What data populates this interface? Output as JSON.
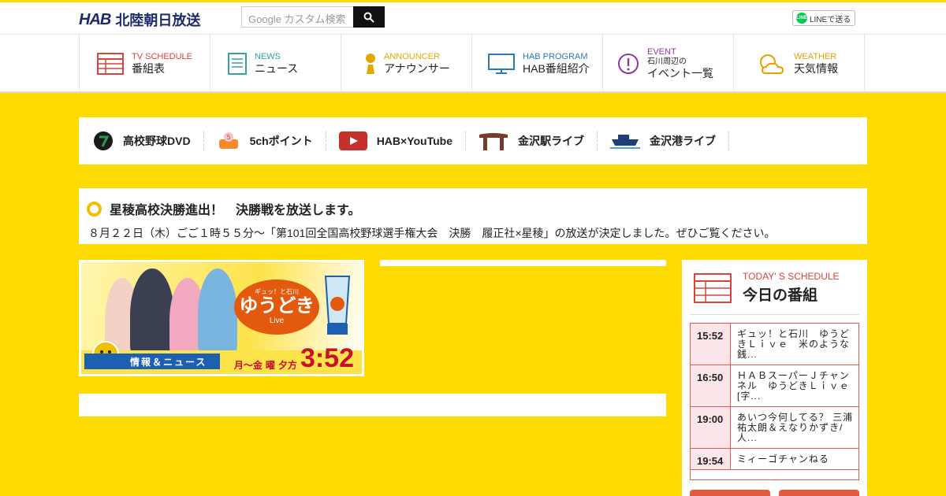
{
  "header": {
    "logo_mark": "HAB",
    "logo_name": "北陸朝日放送",
    "search_placeholder": "Google カスタム検索",
    "line_button": "LINEで送る"
  },
  "nav": [
    {
      "en": "TV SCHEDULE",
      "ja": "番組表",
      "color": "#d9453b",
      "icon": "tv-schedule-icon"
    },
    {
      "en": "NEWS",
      "ja": "ニュース",
      "color": "#34a39a",
      "icon": "news-icon"
    },
    {
      "en": "ANNOUNCER",
      "ja": "アナウンサー",
      "color": "#e0a800",
      "icon": "announcer-icon"
    },
    {
      "en": "HAB PROGRAM",
      "ja": "HAB番組紹介",
      "color": "#2b79b8",
      "icon": "tv-monitor-icon"
    },
    {
      "en": "EVENT",
      "ja_small": "石川周辺の",
      "ja": "イベント一覧",
      "color": "#8e3a9a",
      "icon": "event-icon"
    },
    {
      "en": "WEATHER",
      "ja": "天気情報",
      "color": "#e8a000",
      "icon": "weather-icon"
    }
  ],
  "quick_links": [
    {
      "label": "高校野球DVD",
      "icon": "baseball-dvd-icon"
    },
    {
      "label": "5chポイント",
      "icon": "5ch-point-icon"
    },
    {
      "label": "HAB×YouTube",
      "icon": "youtube-icon"
    },
    {
      "label": "金沢駅ライブ",
      "icon": "kanazawa-station-icon"
    },
    {
      "label": "金沢港ライブ",
      "icon": "kanazawa-port-icon"
    }
  ],
  "notice": {
    "title": "星稜高校決勝進出！　決勝戦を放送します。",
    "body": "８月２２日（木）ごご１時５５分～「第101回全国高校野球選手権大会　決勝　履正社×星稜」の放送が決定しました。ぜひご覧ください。"
  },
  "banner": {
    "logo_top": "ギュッ！と石川",
    "logo_main": "ゆうどき",
    "logo_sub": "Live",
    "info": "情報＆ニュース",
    "days": "月～金",
    "suffix": "曜",
    "evening": "夕方",
    "time": "3:52"
  },
  "today": {
    "en": "TODAY' S SCHEDULE",
    "ja": "今日の番組",
    "rows": [
      {
        "time": "15:52",
        "title": "ギュッ！と石川　ゆうどきＬｉｖｅ　米のような銭..."
      },
      {
        "time": "16:50",
        "title": "ＨＡＢスーパーＪチャンネル　ゆうどきＬｉｖｅ[字..."
      },
      {
        "time": "19:00",
        "title": "あいつ今何してる？ 三浦祐太朗＆えなりかずき/人..."
      },
      {
        "time": "19:54",
        "title": "ミィーゴチャンねる"
      }
    ]
  }
}
